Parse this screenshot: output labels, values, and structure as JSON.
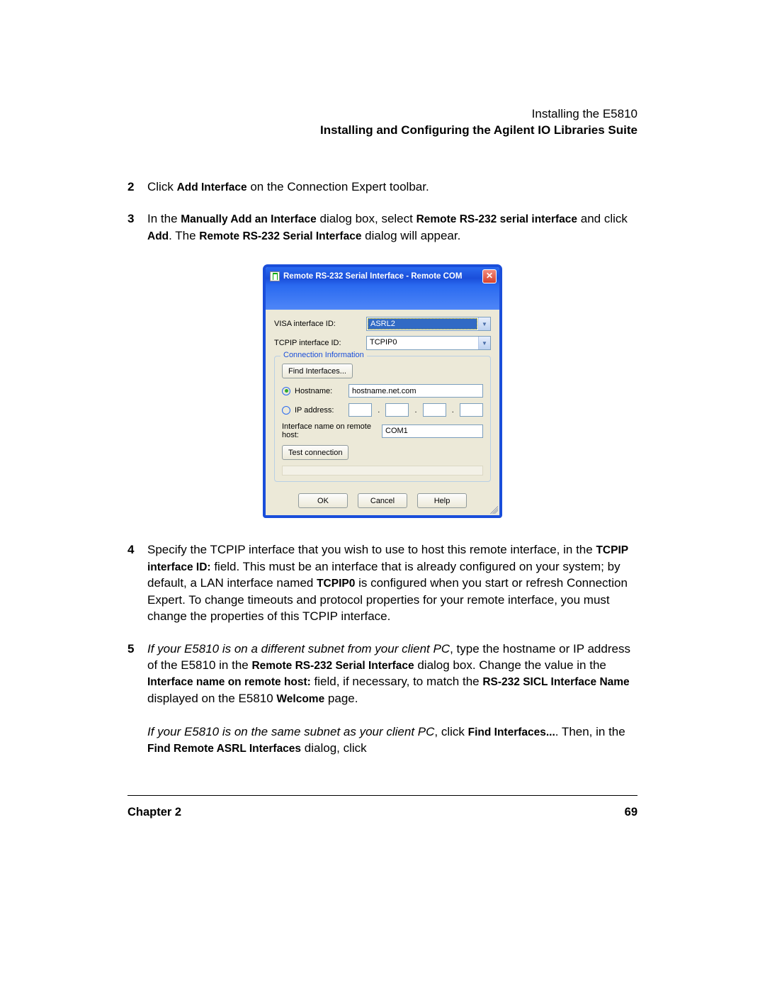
{
  "header": {
    "line1": "Installing the E5810",
    "line2": "Installing and Configuring the Agilent IO Libraries Suite"
  },
  "steps": {
    "s2": {
      "num": "2",
      "t1": "Click ",
      "b1": "Add Interface",
      "t2": " on the Connection Expert toolbar."
    },
    "s3": {
      "num": "3",
      "t1": "In the ",
      "b1": "Manually Add an Interface",
      "t2": " dialog box, select ",
      "b2": "Remote RS-232 serial interface",
      "t3": " and click ",
      "b3": "Add",
      "t4": ". The ",
      "b4": "Remote RS-232 Serial Interface",
      "t5": " dialog will appear."
    },
    "s4": {
      "num": "4",
      "t1": "Specify the TCPIP interface that you wish to use to host this remote interface, in the ",
      "b1": "TCPIP interface ID:",
      "t2": " field. This must be an interface that is already configured on your system; by default, a LAN interface named ",
      "b2": "TCPIP0",
      "t3": " is configured when you start or refresh Connection Expert. To change timeouts and protocol properties for your remote interface, you must change the properties of this TCPIP interface."
    },
    "s5": {
      "num": "5",
      "i1": "If your E5810 is on a different subnet from your client PC",
      "t1": ", type the hostname or IP address of the E5810 in the ",
      "b1": "Remote RS-232 Serial Interface",
      "t2": " dialog box. Change the value in the ",
      "b2": "Interface name on remote host:",
      "t3": " field, if necessary, to match the ",
      "b3": "RS-232 SICL Interface Name",
      "t4": " displayed on the E5810 ",
      "b4": "Welcome",
      "t5": " page.",
      "i2": "If your E5810 is on the same subnet as your client PC",
      "t6": ", click ",
      "b5": "Find Interfaces...",
      "t7": ". Then, in the ",
      "b6": "Find Remote ASRL Interfaces",
      "t8": " dialog, click"
    }
  },
  "dialog": {
    "title": "Remote RS-232 Serial Interface - Remote COM",
    "labels": {
      "visa": "VISA interface ID:",
      "tcpip": "TCPIP interface ID:",
      "groupTitle": "Connection Information",
      "findInterfaces": "Find Interfaces...",
      "hostnameRadio": "Hostname:",
      "ipRadio": "IP address:",
      "ifaceOnRemote": "Interface name on remote host:",
      "testConn": "Test connection",
      "ok": "OK",
      "cancel": "Cancel",
      "help": "Help"
    },
    "values": {
      "visa": "ASRL2",
      "tcpip": "TCPIP0",
      "hostname": "hostname.net.com",
      "remoteIface": "COM1"
    }
  },
  "footer": {
    "chapter": "Chapter 2",
    "page": "69"
  }
}
